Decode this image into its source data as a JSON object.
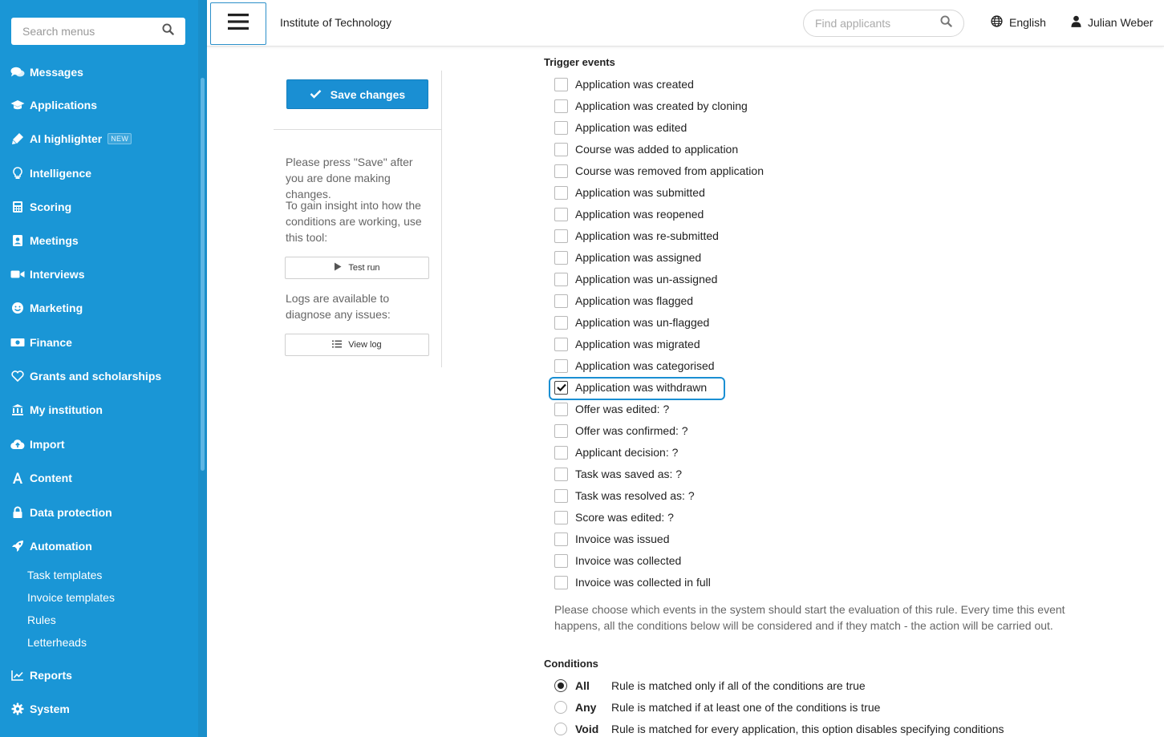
{
  "sidebar": {
    "search_placeholder": "Search menus",
    "items": [
      {
        "label": "Messages",
        "icon": "comments-icon"
      },
      {
        "label": "Applications",
        "icon": "graduation-cap-icon"
      },
      {
        "label": "AI highlighter",
        "icon": "highlighter-icon",
        "badge": "NEW"
      },
      {
        "label": "Intelligence",
        "icon": "lightbulb-icon"
      },
      {
        "label": "Scoring",
        "icon": "calculator-icon"
      },
      {
        "label": "Meetings",
        "icon": "contact-card-icon"
      },
      {
        "label": "Interviews",
        "icon": "video-camera-icon"
      },
      {
        "label": "Marketing",
        "icon": "smile-icon"
      },
      {
        "label": "Finance",
        "icon": "money-bill-icon"
      },
      {
        "label": "Grants and scholarships",
        "icon": "heart-icon"
      },
      {
        "label": "My institution",
        "icon": "institution-icon"
      },
      {
        "label": "Import",
        "icon": "cloud-upload-icon"
      },
      {
        "label": "Content",
        "icon": "font-icon"
      },
      {
        "label": "Data protection",
        "icon": "lock-icon"
      },
      {
        "label": "Automation",
        "icon": "rocket-icon"
      },
      {
        "label": "Reports",
        "icon": "line-chart-icon"
      },
      {
        "label": "System",
        "icon": "gear-icon"
      }
    ],
    "automation_subitems": [
      "Task templates",
      "Invoice templates",
      "Rules",
      "Letterheads"
    ]
  },
  "header": {
    "institution": "Institute of Technology",
    "find_placeholder": "Find applicants",
    "language": "English",
    "user": "Julian Weber"
  },
  "panel": {
    "save_label": "Save changes",
    "help_save": "Please press \"Save\" after you are done making changes.",
    "help_test": "To gain insight into how the conditions are working, use this tool:",
    "test_run_label": "Test run",
    "help_logs": "Logs are available to diagnose any issues:",
    "view_log_label": "View log"
  },
  "trigger_events": {
    "title": "Trigger events",
    "items": [
      {
        "label": "Application was created",
        "checked": false
      },
      {
        "label": "Application was created by cloning",
        "checked": false
      },
      {
        "label": "Application was edited",
        "checked": false
      },
      {
        "label": "Course was added to application",
        "checked": false
      },
      {
        "label": "Course was removed from application",
        "checked": false
      },
      {
        "label": "Application was submitted",
        "checked": false
      },
      {
        "label": "Application was reopened",
        "checked": false
      },
      {
        "label": "Application was re-submitted",
        "checked": false
      },
      {
        "label": "Application was assigned",
        "checked": false
      },
      {
        "label": "Application was un-assigned",
        "checked": false
      },
      {
        "label": "Application was flagged",
        "checked": false
      },
      {
        "label": "Application was un-flagged",
        "checked": false
      },
      {
        "label": "Application was migrated",
        "checked": false
      },
      {
        "label": "Application was categorised",
        "checked": false
      },
      {
        "label": "Application was withdrawn",
        "checked": true
      },
      {
        "label": "Offer was edited: ?",
        "checked": false
      },
      {
        "label": "Offer was confirmed: ?",
        "checked": false
      },
      {
        "label": "Applicant decision: ?",
        "checked": false
      },
      {
        "label": "Task was saved as: ?",
        "checked": false
      },
      {
        "label": "Task was resolved as: ?",
        "checked": false
      },
      {
        "label": "Score was edited: ?",
        "checked": false
      },
      {
        "label": "Invoice was issued",
        "checked": false
      },
      {
        "label": "Invoice was collected",
        "checked": false
      },
      {
        "label": "Invoice was collected in full",
        "checked": false
      }
    ],
    "note": "Please choose which events in the system should start the evaluation of this rule. Every time this event happens, all the conditions below will be considered and if they match - the action will be carried out."
  },
  "conditions": {
    "title": "Conditions",
    "options": [
      {
        "name": "All",
        "description": "Rule is matched only if all of the conditions are true",
        "selected": true
      },
      {
        "name": "Any",
        "description": "Rule is matched if at least one of the conditions is true",
        "selected": false
      },
      {
        "name": "Void",
        "description": "Rule is matched for every application, this option disables specifying conditions",
        "selected": false
      }
    ]
  }
}
